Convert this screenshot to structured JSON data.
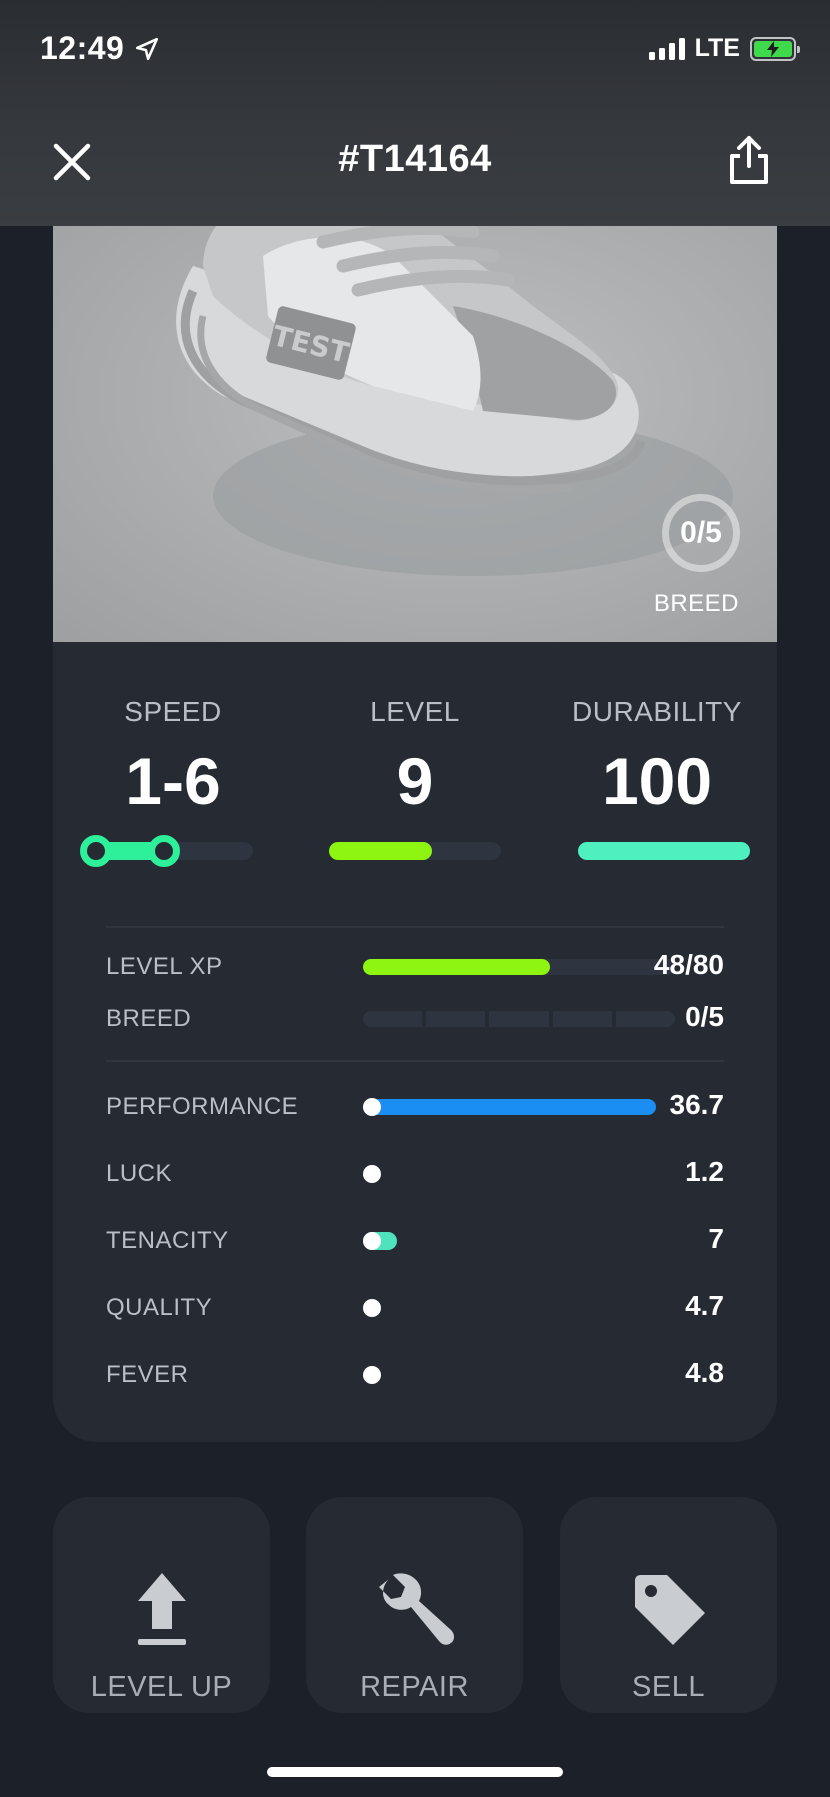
{
  "status_bar": {
    "time": "12:49",
    "network": "LTE"
  },
  "header": {
    "title": "#T14164"
  },
  "hero": {
    "breed_count": "0/5",
    "breed_label": "BREED",
    "shoe_badge": "TEST"
  },
  "stats": {
    "speed": {
      "label": "SPEED",
      "value": "1-6"
    },
    "level": {
      "label": "LEVEL",
      "value": "9",
      "progress": 0.6
    },
    "durability": {
      "label": "DURABILITY",
      "value": "100",
      "progress": 1.0
    }
  },
  "progress": {
    "level_xp": {
      "label": "LEVEL XP",
      "value": "48/80",
      "fraction": 0.6
    },
    "breed": {
      "label": "BREED",
      "value": "0/5",
      "segments": 5,
      "filled": 0
    }
  },
  "attributes": [
    {
      "label": "PERFORMANCE",
      "value": "36.7",
      "fraction": 1.0,
      "color": "#1a8ef2"
    },
    {
      "label": "LUCK",
      "value": "1.2",
      "fraction": 0.0,
      "color": "#ffffff"
    },
    {
      "label": "TENACITY",
      "value": "7",
      "fraction": 0.08,
      "color": "#4fe3bd"
    },
    {
      "label": "QUALITY",
      "value": "4.7",
      "fraction": 0.0,
      "color": "#ffffff"
    },
    {
      "label": "FEVER",
      "value": "4.8",
      "fraction": 0.0,
      "color": "#ffffff"
    }
  ],
  "actions": {
    "level_up": "LEVEL UP",
    "repair": "REPAIR",
    "sell": "SELL"
  },
  "colors": {
    "speed": "#2ff09a",
    "level": "#8ef513",
    "durability": "#4ff0c0",
    "performance": "#1a8ef2"
  }
}
